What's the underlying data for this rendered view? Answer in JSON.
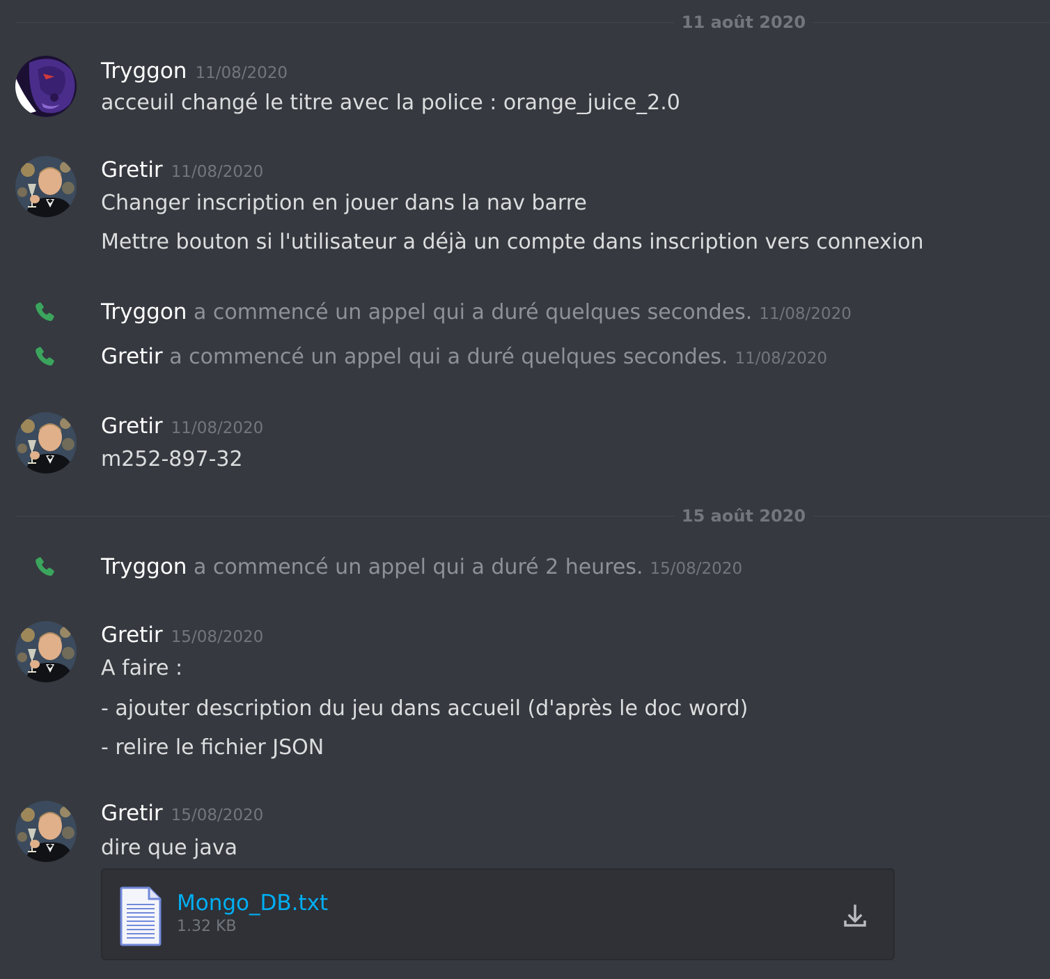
{
  "colors": {
    "background": "#36393f",
    "username": "#ffffff",
    "message_text": "#dcddde",
    "muted": "#72767d",
    "system_text": "#8e9297",
    "call_green": "#3ba55d",
    "link": "#00aff4"
  },
  "dividers": [
    {
      "label": "11 août 2020"
    },
    {
      "label": "15 août 2020"
    }
  ],
  "messages": [
    {
      "author": "Tryggon",
      "timestamp": "11/08/2020",
      "avatar": "tryggon-avatar",
      "lines": [
        "acceuil changé le titre avec la police : orange_juice_2.0"
      ]
    },
    {
      "author": "Gretir",
      "timestamp": "11/08/2020",
      "avatar": "gretir-avatar",
      "lines": [
        "Changer inscription en jouer dans la nav barre",
        "Mettre bouton si l'utilisateur a déjà un compte dans inscription vers connexion"
      ]
    },
    {
      "author": "Gretir",
      "timestamp": "11/08/2020",
      "avatar": "gretir-avatar",
      "lines": [
        "m252-897-32"
      ]
    },
    {
      "author": "Gretir",
      "timestamp": "15/08/2020",
      "avatar": "gretir-avatar",
      "lines": [
        "A faire :",
        "- ajouter description du jeu dans accueil (d'après le doc word)",
        "- relire le fichier JSON"
      ]
    },
    {
      "author": "Gretir",
      "timestamp": "15/08/2020",
      "avatar": "gretir-avatar",
      "lines": [
        "dire que java"
      ],
      "attachment": {
        "file_name": "Mongo_DB.txt",
        "file_size": "1.32 KB",
        "icon": "text-file-icon",
        "action_icon": "download-icon"
      }
    }
  ],
  "calls": [
    {
      "author": "Tryggon",
      "text": "a commencé un appel qui a duré quelques secondes.",
      "timestamp": "11/08/2020",
      "icon": "phone-icon"
    },
    {
      "author": "Gretir",
      "text": "a commencé un appel qui a duré quelques secondes.",
      "timestamp": "11/08/2020",
      "icon": "phone-icon"
    },
    {
      "author": "Tryggon",
      "text": "a commencé un appel qui a duré 2 heures.",
      "timestamp": "15/08/2020",
      "icon": "phone-icon"
    }
  ]
}
